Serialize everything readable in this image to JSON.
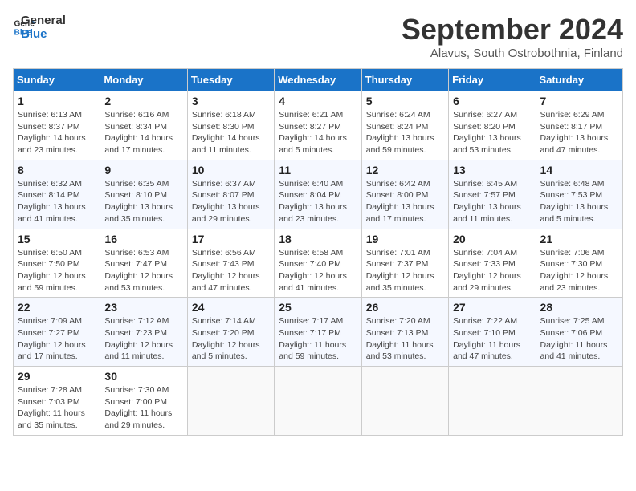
{
  "header": {
    "logo_line1": "General",
    "logo_line2": "Blue",
    "title": "September 2024",
    "subtitle": "Alavus, South Ostrobothnia, Finland"
  },
  "days_of_week": [
    "Sunday",
    "Monday",
    "Tuesday",
    "Wednesday",
    "Thursday",
    "Friday",
    "Saturday"
  ],
  "weeks": [
    [
      {
        "day": "1",
        "detail": "Sunrise: 6:13 AM\nSunset: 8:37 PM\nDaylight: 14 hours\nand 23 minutes."
      },
      {
        "day": "2",
        "detail": "Sunrise: 6:16 AM\nSunset: 8:34 PM\nDaylight: 14 hours\nand 17 minutes."
      },
      {
        "day": "3",
        "detail": "Sunrise: 6:18 AM\nSunset: 8:30 PM\nDaylight: 14 hours\nand 11 minutes."
      },
      {
        "day": "4",
        "detail": "Sunrise: 6:21 AM\nSunset: 8:27 PM\nDaylight: 14 hours\nand 5 minutes."
      },
      {
        "day": "5",
        "detail": "Sunrise: 6:24 AM\nSunset: 8:24 PM\nDaylight: 13 hours\nand 59 minutes."
      },
      {
        "day": "6",
        "detail": "Sunrise: 6:27 AM\nSunset: 8:20 PM\nDaylight: 13 hours\nand 53 minutes."
      },
      {
        "day": "7",
        "detail": "Sunrise: 6:29 AM\nSunset: 8:17 PM\nDaylight: 13 hours\nand 47 minutes."
      }
    ],
    [
      {
        "day": "8",
        "detail": "Sunrise: 6:32 AM\nSunset: 8:14 PM\nDaylight: 13 hours\nand 41 minutes."
      },
      {
        "day": "9",
        "detail": "Sunrise: 6:35 AM\nSunset: 8:10 PM\nDaylight: 13 hours\nand 35 minutes."
      },
      {
        "day": "10",
        "detail": "Sunrise: 6:37 AM\nSunset: 8:07 PM\nDaylight: 13 hours\nand 29 minutes."
      },
      {
        "day": "11",
        "detail": "Sunrise: 6:40 AM\nSunset: 8:04 PM\nDaylight: 13 hours\nand 23 minutes."
      },
      {
        "day": "12",
        "detail": "Sunrise: 6:42 AM\nSunset: 8:00 PM\nDaylight: 13 hours\nand 17 minutes."
      },
      {
        "day": "13",
        "detail": "Sunrise: 6:45 AM\nSunset: 7:57 PM\nDaylight: 13 hours\nand 11 minutes."
      },
      {
        "day": "14",
        "detail": "Sunrise: 6:48 AM\nSunset: 7:53 PM\nDaylight: 13 hours\nand 5 minutes."
      }
    ],
    [
      {
        "day": "15",
        "detail": "Sunrise: 6:50 AM\nSunset: 7:50 PM\nDaylight: 12 hours\nand 59 minutes."
      },
      {
        "day": "16",
        "detail": "Sunrise: 6:53 AM\nSunset: 7:47 PM\nDaylight: 12 hours\nand 53 minutes."
      },
      {
        "day": "17",
        "detail": "Sunrise: 6:56 AM\nSunset: 7:43 PM\nDaylight: 12 hours\nand 47 minutes."
      },
      {
        "day": "18",
        "detail": "Sunrise: 6:58 AM\nSunset: 7:40 PM\nDaylight: 12 hours\nand 41 minutes."
      },
      {
        "day": "19",
        "detail": "Sunrise: 7:01 AM\nSunset: 7:37 PM\nDaylight: 12 hours\nand 35 minutes."
      },
      {
        "day": "20",
        "detail": "Sunrise: 7:04 AM\nSunset: 7:33 PM\nDaylight: 12 hours\nand 29 minutes."
      },
      {
        "day": "21",
        "detail": "Sunrise: 7:06 AM\nSunset: 7:30 PM\nDaylight: 12 hours\nand 23 minutes."
      }
    ],
    [
      {
        "day": "22",
        "detail": "Sunrise: 7:09 AM\nSunset: 7:27 PM\nDaylight: 12 hours\nand 17 minutes."
      },
      {
        "day": "23",
        "detail": "Sunrise: 7:12 AM\nSunset: 7:23 PM\nDaylight: 12 hours\nand 11 minutes."
      },
      {
        "day": "24",
        "detail": "Sunrise: 7:14 AM\nSunset: 7:20 PM\nDaylight: 12 hours\nand 5 minutes."
      },
      {
        "day": "25",
        "detail": "Sunrise: 7:17 AM\nSunset: 7:17 PM\nDaylight: 11 hours\nand 59 minutes."
      },
      {
        "day": "26",
        "detail": "Sunrise: 7:20 AM\nSunset: 7:13 PM\nDaylight: 11 hours\nand 53 minutes."
      },
      {
        "day": "27",
        "detail": "Sunrise: 7:22 AM\nSunset: 7:10 PM\nDaylight: 11 hours\nand 47 minutes."
      },
      {
        "day": "28",
        "detail": "Sunrise: 7:25 AM\nSunset: 7:06 PM\nDaylight: 11 hours\nand 41 minutes."
      }
    ],
    [
      {
        "day": "29",
        "detail": "Sunrise: 7:28 AM\nSunset: 7:03 PM\nDaylight: 11 hours\nand 35 minutes."
      },
      {
        "day": "30",
        "detail": "Sunrise: 7:30 AM\nSunset: 7:00 PM\nDaylight: 11 hours\nand 29 minutes."
      },
      {
        "day": "",
        "detail": ""
      },
      {
        "day": "",
        "detail": ""
      },
      {
        "day": "",
        "detail": ""
      },
      {
        "day": "",
        "detail": ""
      },
      {
        "day": "",
        "detail": ""
      }
    ]
  ]
}
